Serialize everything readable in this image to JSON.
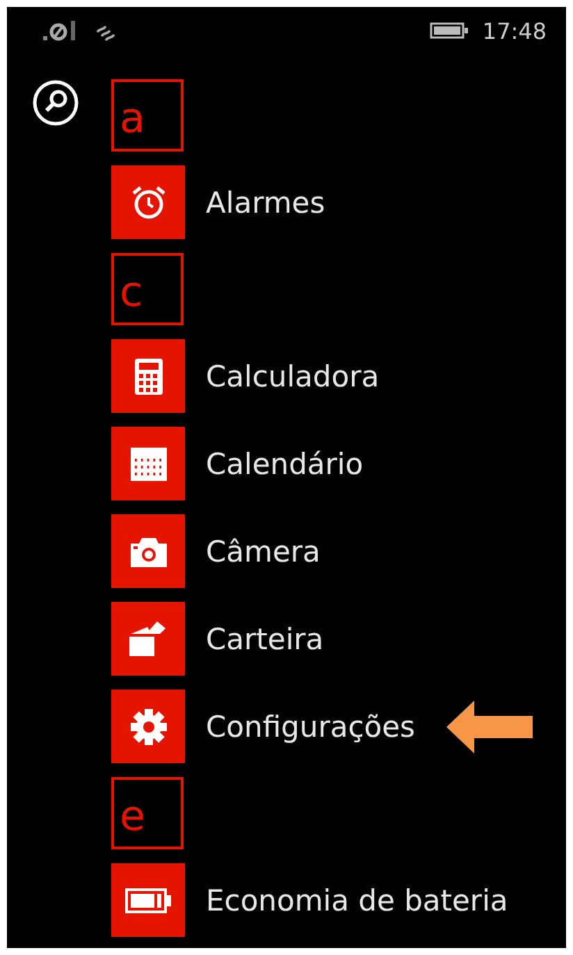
{
  "status_bar": {
    "time": "17:48"
  },
  "items": [
    {
      "kind": "letter",
      "label": "a"
    },
    {
      "kind": "app",
      "label": "Alarmes",
      "highlighted": false
    },
    {
      "kind": "letter",
      "label": "c"
    },
    {
      "kind": "app",
      "label": "Calculadora",
      "highlighted": false
    },
    {
      "kind": "app",
      "label": "Calendário",
      "highlighted": false
    },
    {
      "kind": "app",
      "label": "Câmera",
      "highlighted": false
    },
    {
      "kind": "app",
      "label": "Carteira",
      "highlighted": false
    },
    {
      "kind": "app",
      "label": "Configurações",
      "highlighted": true
    },
    {
      "kind": "letter",
      "label": "e"
    },
    {
      "kind": "app",
      "label": "Economia de bateria",
      "highlighted": false
    }
  ]
}
